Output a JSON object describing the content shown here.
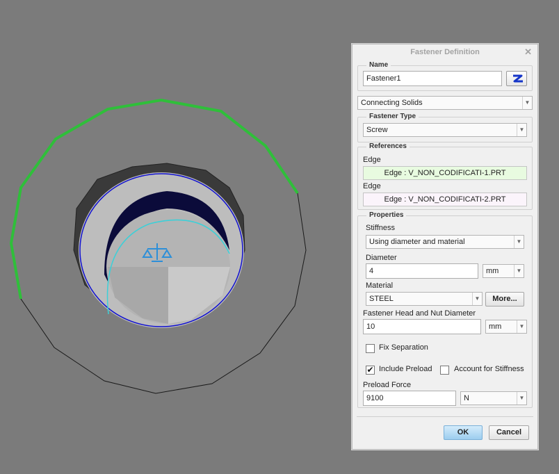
{
  "dialog": {
    "title": "Fastener Definition",
    "close_glyph": "✕",
    "name_group": {
      "legend": "Name",
      "value": "Fastener1",
      "icon": "blue-link-icon"
    },
    "connection_type": "Connecting Solids",
    "fastener_type": {
      "legend": "Fastener Type",
      "selected": "Screw"
    },
    "references": {
      "legend": "References",
      "edge1": {
        "label": "Edge",
        "value": "Edge : V_NON_CODIFICATI-1.PRT",
        "color": "#e8fbe0"
      },
      "edge2": {
        "label": "Edge",
        "value": "Edge : V_NON_CODIFICATI-2.PRT",
        "color": "#fbf4fb"
      }
    },
    "properties": {
      "legend": "Properties",
      "stiffness_label": "Stiffness",
      "stiffness_value": "Using diameter and material",
      "diameter_label": "Diameter",
      "diameter_value": "4",
      "diameter_unit": "mm",
      "material_label": "Material",
      "material_value": "STEEL",
      "more_button": "More...",
      "head_label": "Fastener Head and Nut Diameter",
      "head_value": "10",
      "head_unit": "mm",
      "fix_separation": {
        "label": "Fix Separation",
        "checked": false
      },
      "include_preload": {
        "label": "Include Preload",
        "checked": true
      },
      "account_stiffness": {
        "label": "Account for Stiffness",
        "checked": false
      },
      "preload_label": "Preload Force",
      "preload_value": "9100",
      "preload_unit": "N"
    },
    "ok_button": "OK",
    "cancel_button": "Cancel"
  },
  "colors": {
    "viewport_bg": "#7b7b7b",
    "edge_highlight": "#2fbf3a",
    "hole_edge": "#1010d0",
    "thread_curve": "#3cd0d8"
  }
}
